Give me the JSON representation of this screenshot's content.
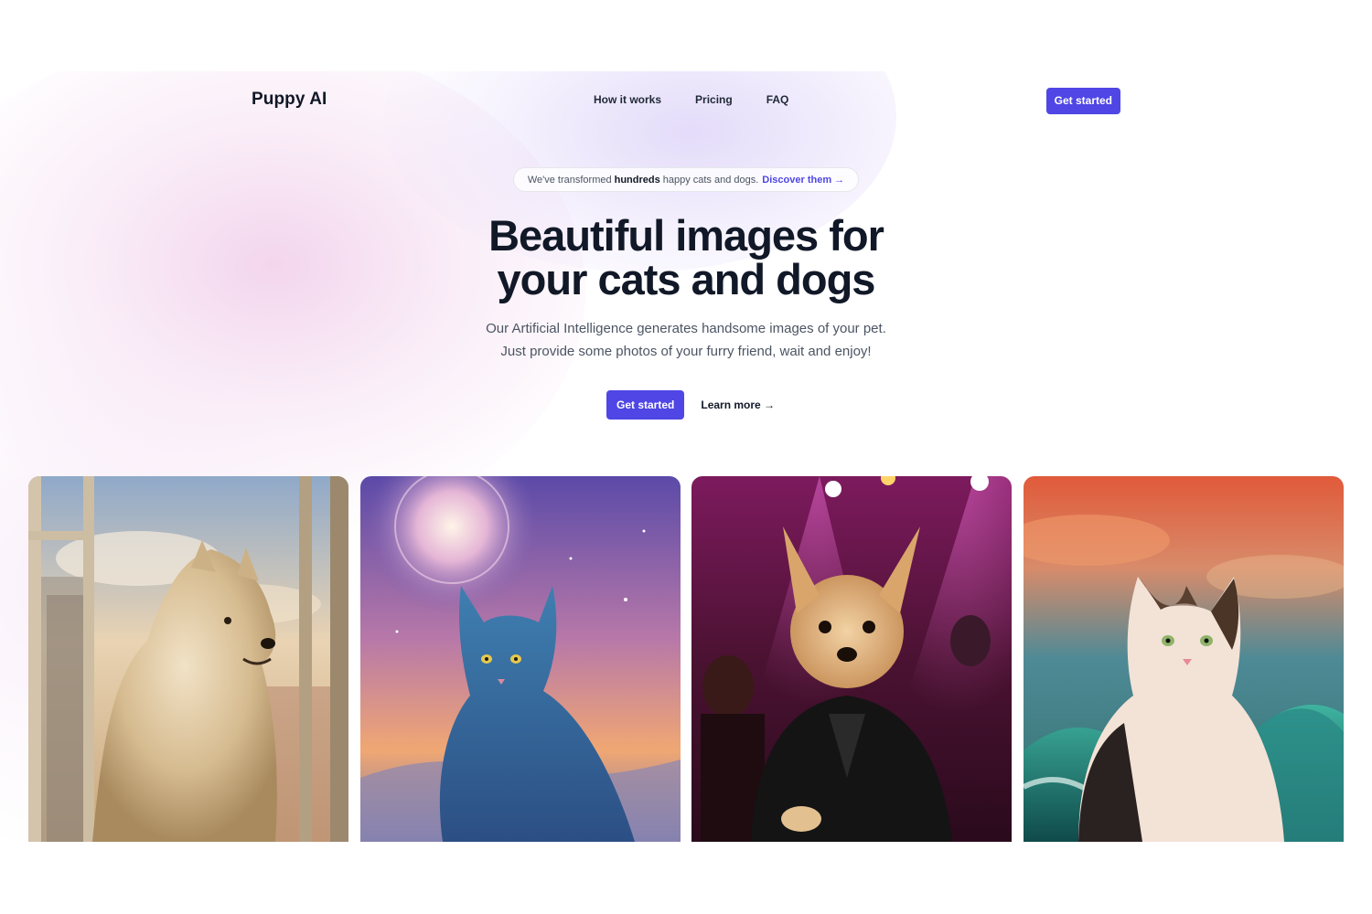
{
  "header": {
    "logo": "Puppy AI",
    "nav": [
      {
        "label": "How it works"
      },
      {
        "label": "Pricing"
      },
      {
        "label": "FAQ"
      }
    ],
    "cta_label": "Get started"
  },
  "announcement": {
    "prefix": "We've transformed",
    "emphasis": "hundreds",
    "suffix": "happy cats and dogs.",
    "link": "Discover them →"
  },
  "hero": {
    "title_line1": "Beautiful images for",
    "title_line2": "your cats and dogs",
    "subtitle_line1": "Our Artificial Intelligence generates handsome images of your pet.",
    "subtitle_line2": "Just provide some photos of your furry friend, wait and enjoy!",
    "primary_button": "Get started",
    "secondary_button": "Learn more →"
  },
  "theme": {
    "accent": "#4f46e5",
    "text_dark": "#111827",
    "text_muted": "#4b5563"
  },
  "gallery": [
    {
      "name": "samoyed-window-image"
    },
    {
      "name": "blue-cat-space-image"
    },
    {
      "name": "chihuahua-leather-jacket-image"
    },
    {
      "name": "calico-cat-waves-image"
    }
  ]
}
